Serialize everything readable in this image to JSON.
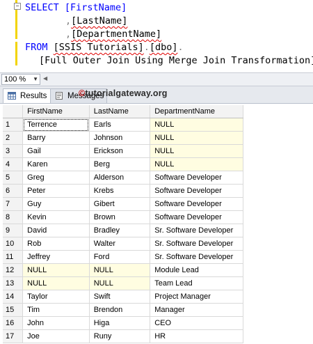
{
  "editor": {
    "line1": "SELECT [FirstName]",
    "line2_comma": ",",
    "line2_col": "[LastName]",
    "line3_comma": ",",
    "line3_col": "[DepartmentName]",
    "from_kw": "FROM",
    "from_db": "[SSIS Tutorials]",
    "from_dot1": ".",
    "from_schema": "[dbo]",
    "from_dot2": ".",
    "table": "[Full Outer Join Using Merge Join Transformation]"
  },
  "zoom": {
    "value": "100 %"
  },
  "tabs": [
    {
      "label": "Results"
    },
    {
      "label": "Messages"
    }
  ],
  "watermark": {
    "symbol": "©",
    "text": "tutorialgateway.org"
  },
  "grid": {
    "columns": [
      "",
      "FirstName",
      "LastName",
      "DepartmentName"
    ],
    "rows": [
      [
        "1",
        "Terrence",
        "Earls",
        "NULL"
      ],
      [
        "2",
        "Barry",
        "Johnson",
        "NULL"
      ],
      [
        "3",
        "Gail",
        "Erickson",
        "NULL"
      ],
      [
        "4",
        "Karen",
        "Berg",
        "NULL"
      ],
      [
        "5",
        "Greg",
        "Alderson",
        "Software Developer"
      ],
      [
        "6",
        "Peter",
        "Krebs",
        "Software Developer"
      ],
      [
        "7",
        "Guy",
        "Gibert",
        "Software Developer"
      ],
      [
        "8",
        "Kevin",
        "Brown",
        "Software Developer"
      ],
      [
        "9",
        "David",
        "Bradley",
        "Sr. Software Developer"
      ],
      [
        "10",
        "Rob",
        "Walter",
        "Sr. Software Developer"
      ],
      [
        "11",
        "Jeffrey",
        "Ford",
        "Sr. Software Developer"
      ],
      [
        "12",
        "NULL",
        "NULL",
        "Module Lead"
      ],
      [
        "13",
        "NULL",
        "NULL",
        "Team Lead"
      ],
      [
        "14",
        "Taylor",
        "Swift",
        "Project Manager"
      ],
      [
        "15",
        "Tim",
        "Brendon",
        "Manager"
      ],
      [
        "16",
        "John",
        "Higa",
        "CEO"
      ],
      [
        "17",
        "Joe",
        "Runy",
        "HR"
      ]
    ]
  }
}
